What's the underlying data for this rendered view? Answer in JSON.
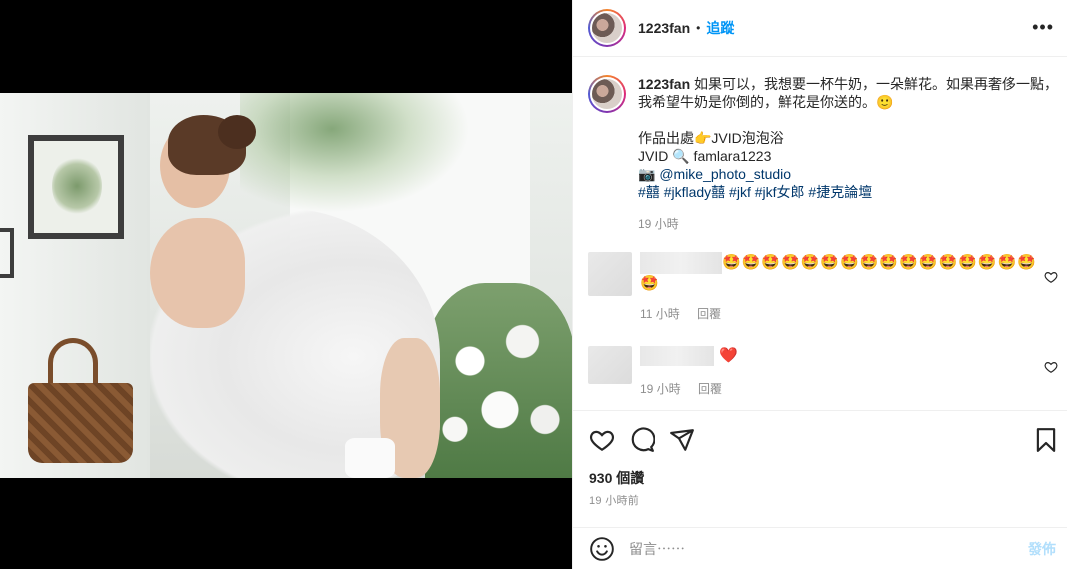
{
  "post": {
    "username": "1223fan",
    "follow_label": "追蹤",
    "separator": "•",
    "more_label": "•••"
  },
  "caption": {
    "username": "1223fan",
    "line1": "如果可以，我想要一杯牛奶，一朵鮮花。如果再奢侈一點，",
    "line2": "我希望牛奶是你倒的，鮮花是你送的。🙂",
    "source": "作品出處👉JVID泡泡浴",
    "jvid": "JVID 🔍 famlara1223",
    "studio": "📷 @mike_photo_studio",
    "hashtags": [
      "#囍",
      "#jkflady囍",
      "#jkf",
      "#jkf女郎",
      "#捷克論壇"
    ],
    "time": "19 小時"
  },
  "comments": [
    {
      "emoji_line1": "🤩🤩🤩🤩🤩🤩🤩🤩🤩🤩🤩🤩🤩🤩🤩🤩",
      "emoji_line2": "🤩",
      "time": "11 小時",
      "reply_label": "回覆"
    },
    {
      "emoji_line1": "❤️",
      "time": "19 小時",
      "reply_label": "回覆"
    }
  ],
  "likes": "930 個讚",
  "post_time": "19 小時前",
  "comment_input": {
    "placeholder": "留言⋯⋯",
    "post_label": "發佈"
  },
  "colors": {
    "accent": "#0095f6",
    "hashtag": "#00376b",
    "muted": "#8e8e8e",
    "post_disabled": "#b2dffc",
    "heart_red": "#ed4956"
  }
}
